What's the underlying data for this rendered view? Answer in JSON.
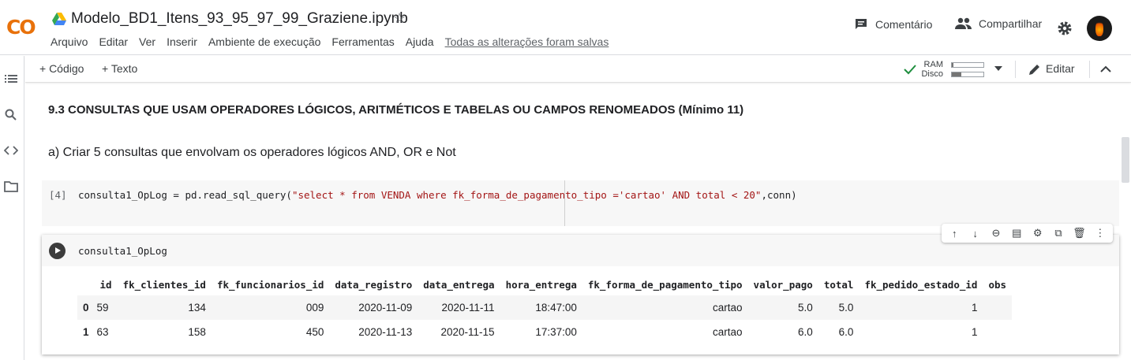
{
  "app": {
    "logo": "CO",
    "notebook_title": "Modelo_BD1_Itens_93_95_97_99_Graziene.ipynb",
    "menu": [
      "Arquivo",
      "Editar",
      "Ver",
      "Inserir",
      "Ambiente de execução",
      "Ferramentas",
      "Ajuda"
    ],
    "saved_status": "Todas as alterações foram salvas",
    "comment_label": "Comentário",
    "share_label": "Compartilhar"
  },
  "toolbar": {
    "add_code": "+ Código",
    "add_text": "+ Texto",
    "ram_label": "RAM",
    "disk_label": "Disco",
    "ram_usage": 0.05,
    "disk_usage": 0.3,
    "edit_label": "Editar"
  },
  "cells": {
    "heading": "9.3 CONSULTAS QUE USAM OPERADORES LÓGICOS, ARITMÉTICOS E TABELAS OU CAMPOS RENOMEADOS (Mínimo 11)",
    "paragraph": "a) Criar 5 consultas que envolvam os operadores lógicos AND, OR e Not",
    "code_cell": {
      "exec_count": "[4]",
      "code_prefix": "consulta1_OpLog = pd.read_sql_query(",
      "code_string": "\"select * from VENDA where fk_forma_de_pagamento_tipo ='cartao' AND total < 20\"",
      "code_suffix": ",conn)"
    },
    "active_cell": {
      "code": "consulta1_OpLog"
    }
  },
  "dataframe": {
    "columns": [
      "",
      "id",
      "fk_clientes_id",
      "fk_funcionarios_id",
      "data_registro",
      "data_entrega",
      "hora_entrega",
      "fk_forma_de_pagamento_tipo",
      "valor_pago",
      "total",
      "fk_pedido_estado_id",
      "obs"
    ],
    "rows": [
      [
        "0",
        "59",
        "134",
        "009",
        "2020-11-09",
        "2020-11-11",
        "18:47:00",
        "cartao",
        "5.0",
        "5.0",
        "1",
        ""
      ],
      [
        "1",
        "63",
        "158",
        "450",
        "2020-11-13",
        "2020-11-15",
        "17:37:00",
        "cartao",
        "6.0",
        "6.0",
        "1",
        ""
      ]
    ]
  },
  "colors": {
    "logo_orange": "#f9ab00",
    "logo_dark_orange": "#e8710a",
    "check_green": "#1e8e3e",
    "string_red": "#a31515"
  }
}
